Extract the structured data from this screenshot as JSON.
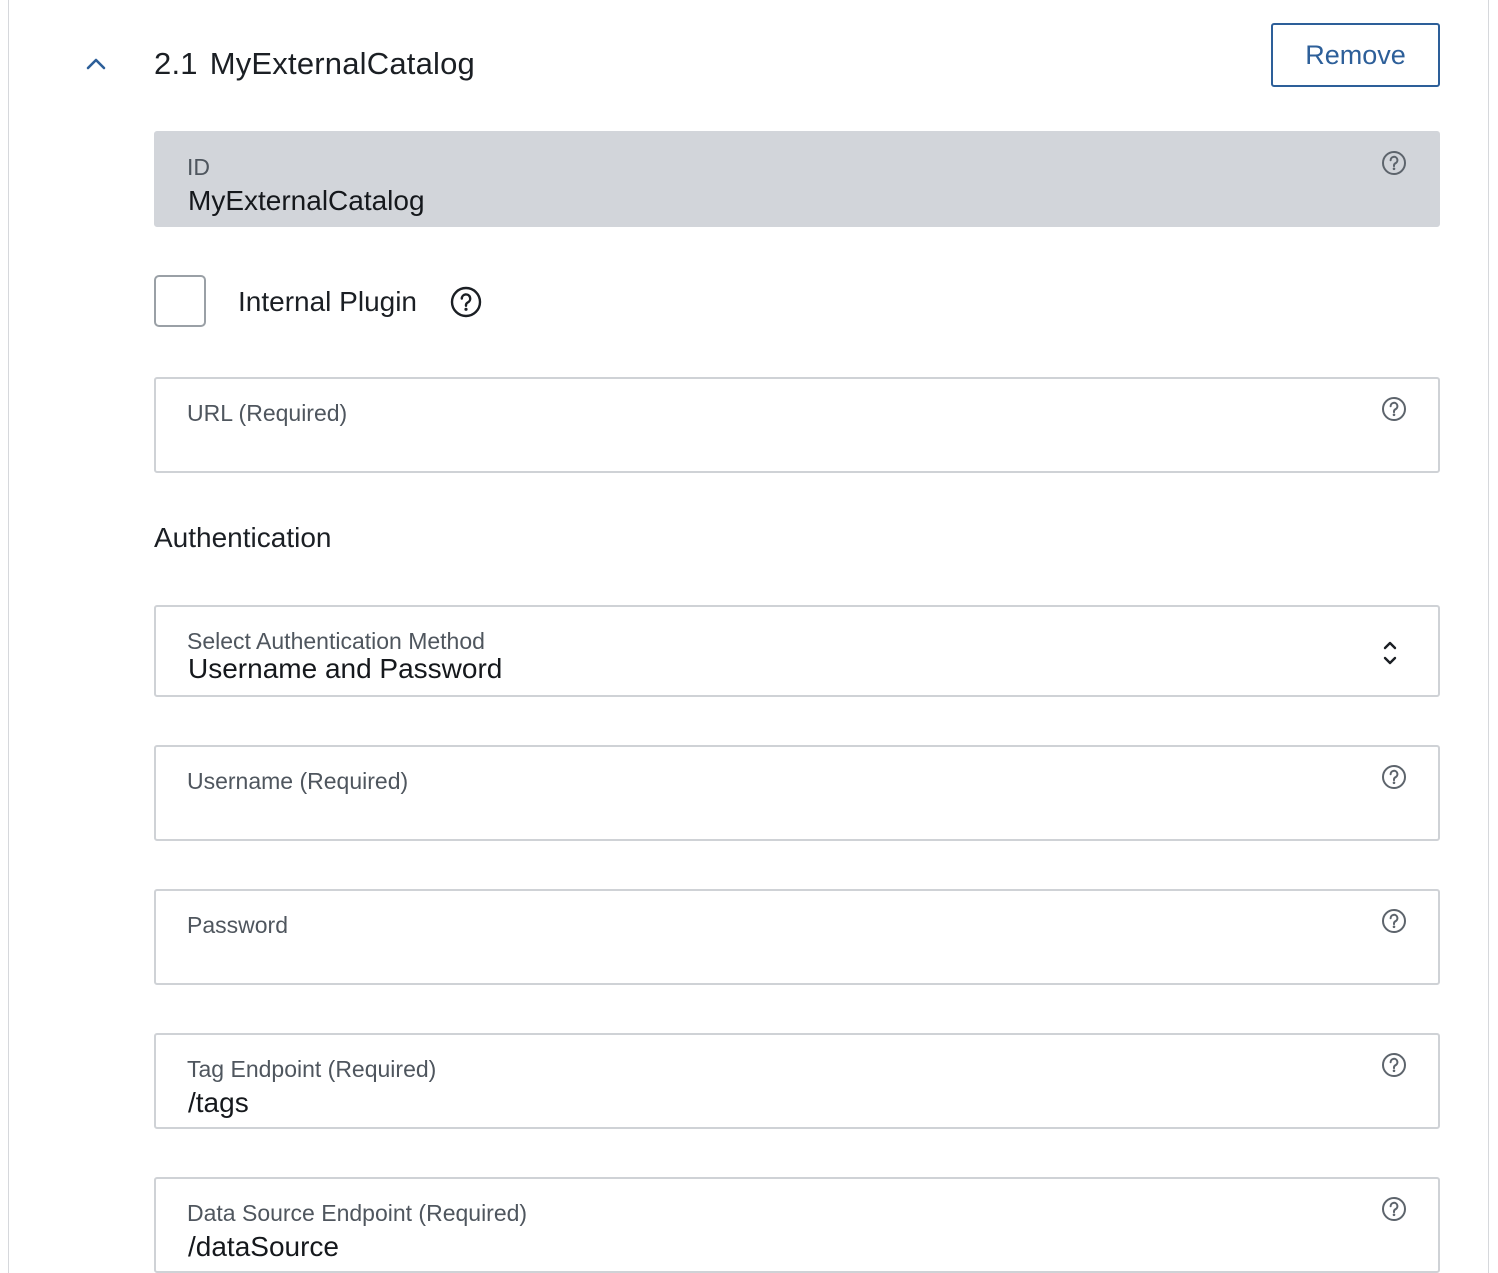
{
  "section": {
    "number": "2.1",
    "title": "MyExternalCatalog",
    "remove_label": "Remove"
  },
  "id_field": {
    "label": "ID",
    "value": "MyExternalCatalog"
  },
  "internal_plugin": {
    "label": "Internal Plugin",
    "checked": false
  },
  "url_field": {
    "label": "URL (Required)",
    "value": ""
  },
  "authentication": {
    "heading": "Authentication",
    "method_label": "Select Authentication Method",
    "method_value": "Username and Password"
  },
  "username_field": {
    "label": "Username (Required)",
    "value": ""
  },
  "password_field": {
    "label": "Password",
    "value": ""
  },
  "tag_endpoint_field": {
    "label": "Tag Endpoint (Required)",
    "value": "/tags"
  },
  "data_source_endpoint_field": {
    "label": "Data Source Endpoint (Required)",
    "value": "/dataSource"
  },
  "icons": {
    "collapse": "chevron-up-icon",
    "help": "question-circle-icon",
    "select": "select-arrows-icon"
  },
  "colors": {
    "accent": "#2d5f99",
    "readonly_bg": "#d2d5da",
    "border": "#cfd2d6"
  }
}
